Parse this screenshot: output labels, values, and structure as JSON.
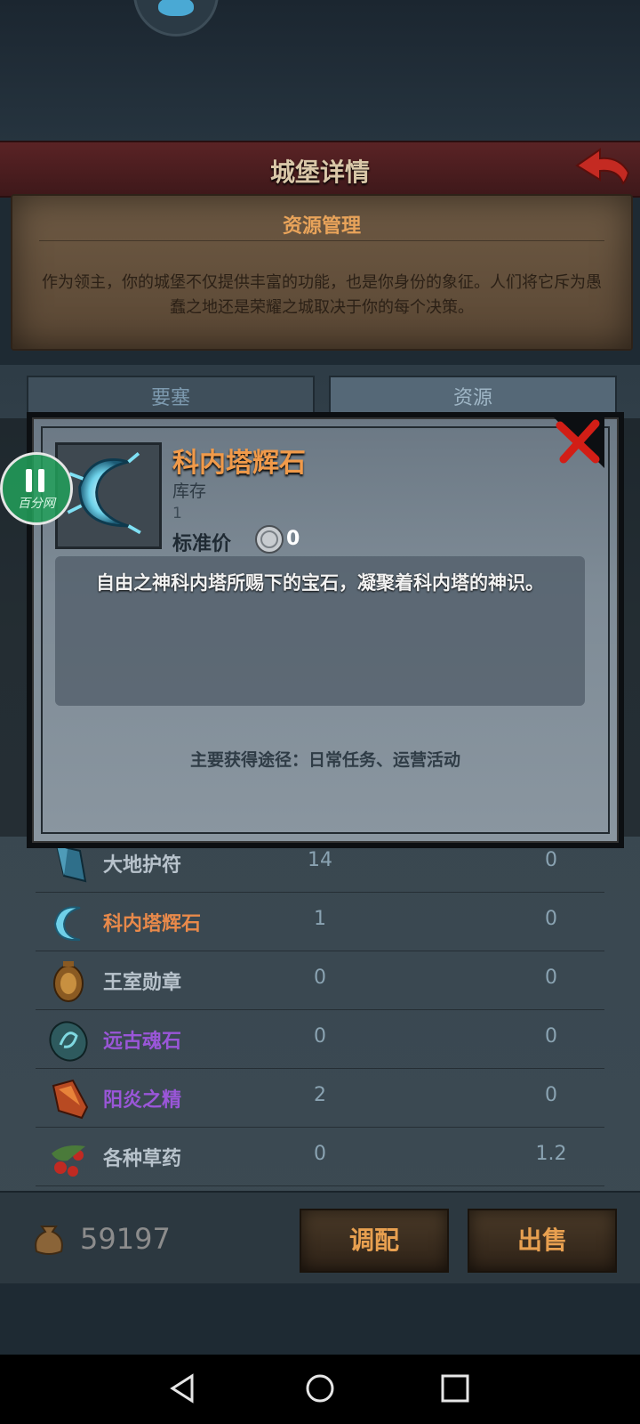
{
  "header": {
    "title": "城堡详情"
  },
  "parchment": {
    "title": "资源管理",
    "text": "作为领主，你的城堡不仅提供丰富的功能，也是你身份的象征。人们将它斥为愚蠢之地还是荣耀之城取决于你的每个决策。"
  },
  "tabs": [
    {
      "label": "要塞"
    },
    {
      "label": "资源"
    }
  ],
  "resources": [
    {
      "name": "大地护符",
      "stock": "14",
      "price": "0",
      "name_color": "#b8c3cc",
      "icon": "earth-amulet-icon"
    },
    {
      "name": "科内塔辉石",
      "stock": "1",
      "price": "0",
      "name_color": "#e8894a",
      "icon": "konetta-stone-icon"
    },
    {
      "name": "王室勋章",
      "stock": "0",
      "price": "0",
      "name_color": "#b8c3cc",
      "icon": "royal-medal-icon"
    },
    {
      "name": "远古魂石",
      "stock": "0",
      "price": "0",
      "name_color": "#9a56d8",
      "icon": "ancient-soulstone-icon"
    },
    {
      "name": "阳炎之精",
      "stock": "2",
      "price": "0",
      "name_color": "#9a56d8",
      "icon": "sun-flame-essence-icon"
    },
    {
      "name": "各种草药",
      "stock": "0",
      "price": "1.2",
      "name_color": "#b8c3cc",
      "icon": "herbs-icon"
    }
  ],
  "bottom": {
    "coins": "59197",
    "mix_label": "调配",
    "sell_label": "出售"
  },
  "modal": {
    "item_name": "科内塔辉石",
    "stock_label": "库存",
    "stock_value": "1",
    "price_label": "标准价",
    "price_value": "0",
    "description": "自由之神科内塔所赐下的宝石，凝聚着科内塔的神识。",
    "source": "主要获得途径：日常任务、运营活动"
  },
  "pause_overlay": {
    "label": "百分网"
  }
}
